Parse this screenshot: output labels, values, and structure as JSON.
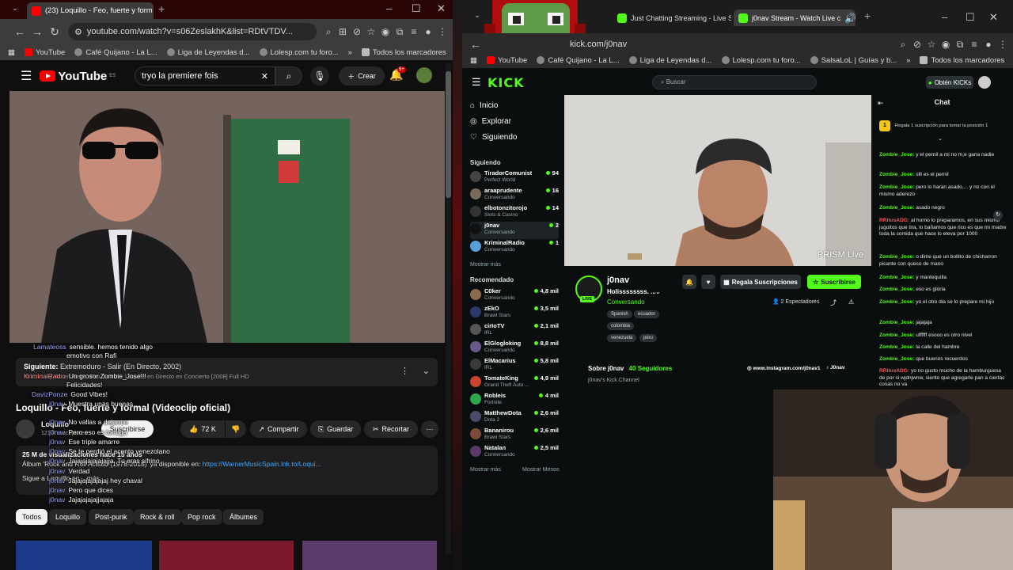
{
  "left": {
    "tabs": [
      {
        "title": "(23) Loquillo - Feo, fuerte y form"
      }
    ],
    "url": "youtube.com/watch?v=s06ZeslakhK&list=RDtVTDV...",
    "bookmarks": [
      "YouTube",
      "Café Quijano - La L...",
      "Liga de Leyendas d...",
      "Lolesp.com tu foro...",
      "»",
      "Todos los marcadores"
    ],
    "yt": {
      "logo": "YouTube",
      "region": "ES",
      "search_value": "tryo la premiere fois",
      "create_label": "Crear",
      "notif_badge": "9+",
      "next_label": "Siguiente:",
      "next_title": "Extremoduro - Salir (En Directo, 2002)",
      "next_sub": "Mix: A Loquillo en Iberia. Feo, fuerte... Loquillo en Directo en Concierto [2008] Full HD",
      "video_title": "Loquillo - Feo, fuerte y formal (Videoclip oficial)",
      "channel": "Loquillo",
      "subs": "121 K suscriptores",
      "subscribe": "Suscribirse",
      "likes": "72 K",
      "share": "Compartir",
      "save": "Guardar",
      "clip": "Recortar",
      "views": "25 M de visualizaciones  hace 15 años",
      "album": "Álbum 'Rock and Roll Actitud (1978-2018)' ya disponible en:",
      "album_link": "https://WarnerMusicSpain.lnk.to/Loqui...",
      "more": "Sigue a Loquillo en ...más",
      "chips": [
        "Todos",
        "Loquillo",
        "Post-punk",
        "Rock & roll",
        "Pop rock",
        "Álbumes"
      ]
    },
    "overlay_chat": [
      {
        "u": "Lamateoss",
        "t": "sensible. hemos tenido algo"
      },
      {
        "u": "",
        "t": "emotivo con Rafi"
      },
      {
        "u": "KriminalRadio",
        "t": "Un grosor Zombie_Jose!!!"
      },
      {
        "u": "",
        "t": "Felicidades!"
      },
      {
        "u": "DavizPonze",
        "t": "Good Vibes!"
      },
      {
        "u": "j0nav",
        "t": "Muestra unas buenas"
      },
      {
        "u": "j0nav",
        "t": "Pero eso es tortuga"
      },
      {
        "u": "j0nav",
        "t": "Ese triple amarre"
      },
      {
        "u": "j0nav",
        "t": "No vallas a dejarme"
      },
      {
        "u": "j0nav",
        "t": "Se te perdió el acento venezolano"
      },
      {
        "u": "j0nav",
        "t": "Jajajajajajajajja. Tu eras sifrino"
      },
      {
        "u": "j0nav",
        "t": "Verdad"
      },
      {
        "u": "j0nav",
        "t": "Jajajajajajajaj hey chaval"
      },
      {
        "u": "j0nav",
        "t": "Pero que dices"
      },
      {
        "u": "j0nav",
        "t": "Jajajajajajjajaja"
      }
    ]
  },
  "right": {
    "tabs": [
      {
        "title": "Just Chatting Streaming - Live S"
      },
      {
        "title": "j0nav Stream - Watch Live c"
      }
    ],
    "url": "kick.com/j0nav",
    "bookmarks": [
      "YouTube",
      "Café Quijano - La L...",
      "Liga de Leyendas d...",
      "Lolesp.com tu foro...",
      "SalsaLoL | Guías y b...",
      "»",
      "Todos los marcadores"
    ],
    "kick": {
      "logo": "KICK",
      "search_placeholder": "Buscar",
      "get_kicks": "Obtén KICKs",
      "nav": [
        "Inicio",
        "Explorar",
        "Siguiendo"
      ],
      "following_title": "Siguiendo",
      "following": [
        {
          "name": "TiradorComunista",
          "cat": "Perfect World",
          "viewers": "94"
        },
        {
          "name": "araaprudente",
          "cat": "Conversando",
          "viewers": "16"
        },
        {
          "name": "elbotonzitorojo",
          "cat": "Slots & Casino",
          "viewers": "14"
        },
        {
          "name": "j0nav",
          "cat": "Conversando",
          "viewers": "2"
        },
        {
          "name": "KriminalRadio",
          "cat": "Conversando",
          "viewers": "1"
        }
      ],
      "show_more": "Mostrar más",
      "recommended_title": "Recomendado",
      "recommended": [
        {
          "name": "C0ker",
          "cat": "Conversando",
          "viewers": "4,8 mil"
        },
        {
          "name": "zEkO",
          "cat": "Brawl Stars",
          "viewers": "3,5 mil"
        },
        {
          "name": "cirIoTV",
          "cat": "IRL",
          "viewers": "2,1 mil"
        },
        {
          "name": "ElGlogloking",
          "cat": "Conversando",
          "viewers": "8,8 mil"
        },
        {
          "name": "ElMacarius",
          "cat": "IRL",
          "viewers": "5,8 mil"
        },
        {
          "name": "TomateKing",
          "cat": "Grand Theft Auto ...",
          "viewers": "4,9 mil"
        },
        {
          "name": "Robleis",
          "cat": "Fortnite",
          "viewers": "4 mil"
        },
        {
          "name": "MatthewDota",
          "cat": "Dota 2",
          "viewers": "2,6 mil"
        },
        {
          "name": "Bananirou",
          "cat": "Brawl Stars",
          "viewers": "2,6 mil"
        },
        {
          "name": "Natalan",
          "cat": "Conversando",
          "viewers": "2,5 mil"
        }
      ],
      "show_more2": "Mostrar más",
      "show_less": "Mostrar Menos",
      "watermark": "PRISM Live",
      "streamer": "j0nav",
      "live_badge": "LIVE",
      "stream_title": "Holissssssss. ...",
      "category": "Conversando",
      "tags": [
        "Spanish",
        "ecuador",
        "colombia",
        "venezuela",
        "péru"
      ],
      "gift_subs": "Regala Suscripciones",
      "subscribe": "Suscribirse",
      "viewers": "2 Espectadores",
      "about": "Sobre j0nav",
      "followers": "40 Seguidores",
      "channel_desc": "j0nav's Kick Channel",
      "instagram": "www.instagram.com/j0nav1",
      "tiktok": "J0nav",
      "chat_title": "Chat",
      "gift_banner": "Regala 1 suscripción para tomar la posición 1",
      "gift_rank": "1",
      "messages": [
        {
          "u": "Zombie_Jose:",
          "t": "y el pernil a mi no m,e gana nadie",
          "red": false
        },
        {
          "u": "Zombie_Jose:",
          "t": "slll es el pernil",
          "red": false
        },
        {
          "u": "Zombie_Jose:",
          "t": "pero lo haran asado,... y no con el mismo aderezo",
          "red": false
        },
        {
          "u": "Zombie_Jose:",
          "t": "asado negro",
          "red": false
        },
        {
          "u": "RRitosADG:",
          "t": "al horno lo preparamos, en sus mismo juguitos que tira, lo bañamos que rico es que mi madre toda la comida que hace lo eleva por 1000",
          "red": true
        },
        {
          "u": "Zombie_Jose:",
          "t": "o dime que un bollito de chicharron picante con queso de mano",
          "red": false
        },
        {
          "u": "Zombie_Jose:",
          "t": "y mantequilla",
          "red": false
        },
        {
          "u": "Zombie_Jose:",
          "t": "eso es gloria",
          "red": false
        },
        {
          "u": "Zombie_Jose:",
          "t": "yo el otro dia se lo prepare mi hijo",
          "red": false
        },
        {
          "u": "Zombie_Jose:",
          "t": "jajajaja",
          "red": false
        },
        {
          "u": "Zombie_Jose:",
          "t": "uffffff esooo es otro nivel",
          "red": false
        },
        {
          "u": "Zombie_Jose:",
          "t": "la calle del hambre",
          "red": false
        },
        {
          "u": "Zombie_Jose:",
          "t": "que buenos recuerdos",
          "red": false
        },
        {
          "u": "RRitosADG:",
          "t": "yo no gusto mucho de la hamburguesa de por si wjdnjwnw, siento que agregarle pan a ciertas cosas no va",
          "red": true
        }
      ]
    }
  },
  "colors": {
    "kick_green": "#53fc18",
    "yt_red": "#ff0000",
    "chat_red": "#ff5757"
  }
}
